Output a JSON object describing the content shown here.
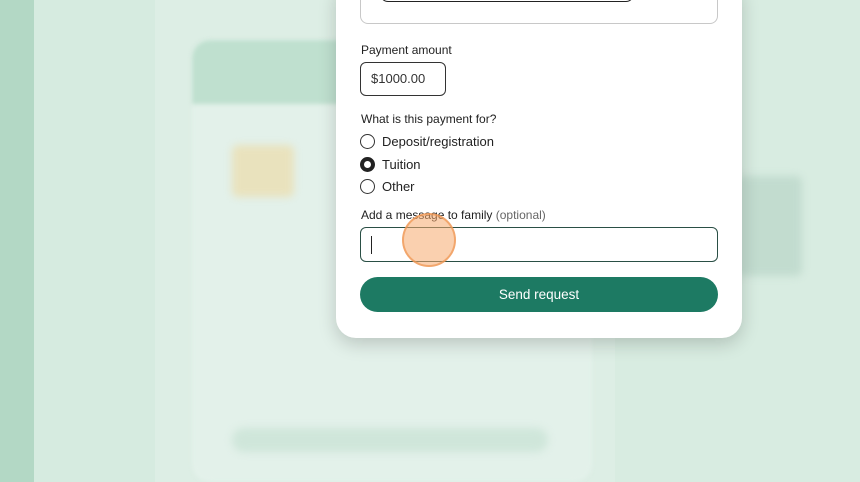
{
  "form": {
    "amount_label": "Payment amount",
    "amount_value": "$1000.00",
    "purpose_label": "What is this payment for?",
    "purpose_options": [
      {
        "label": "Deposit/registration",
        "checked": false
      },
      {
        "label": "Tuition",
        "checked": true
      },
      {
        "label": "Other",
        "checked": false
      }
    ],
    "message_label": "Add a message to family",
    "message_optional": "(optional)",
    "message_value": "",
    "send_label": "Send request"
  },
  "colors": {
    "accent": "#1d7a63",
    "backdrop": "#d6ebe0"
  }
}
